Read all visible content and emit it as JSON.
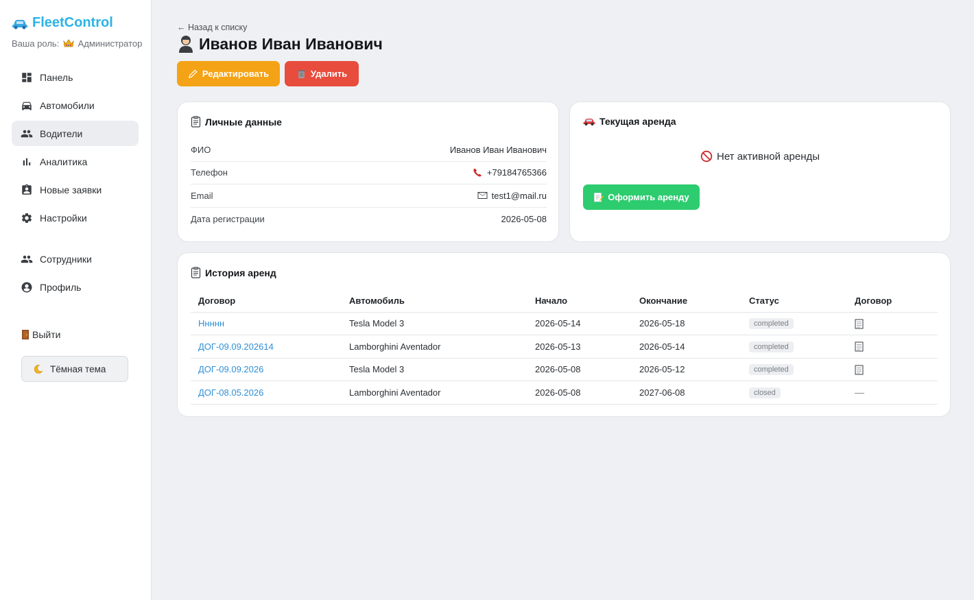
{
  "sidebar": {
    "brand": "FleetControl",
    "role_prefix": "Ваша роль:",
    "role": "Администратор",
    "nav": [
      {
        "label": "Панель",
        "icon": "dashboard-icon"
      },
      {
        "label": "Автомобили",
        "icon": "car-icon"
      },
      {
        "label": "Водители",
        "icon": "people-icon",
        "active": true
      },
      {
        "label": "Аналитика",
        "icon": "bar-chart-icon"
      },
      {
        "label": "Новые заявки",
        "icon": "clipboard-person-icon"
      },
      {
        "label": "Настройки",
        "icon": "gear-icon"
      }
    ],
    "nav2": [
      {
        "label": "Сотрудники",
        "icon": "people-icon"
      },
      {
        "label": "Профиль",
        "icon": "account-circle-icon"
      }
    ],
    "logout": "Выйти",
    "theme": "Тёмная тема"
  },
  "header": {
    "back": "← Назад к списку",
    "title": "Иванов Иван Иванович",
    "edit": "Редактировать",
    "delete": "Удалить"
  },
  "personal": {
    "title": "Личные данные",
    "rows": [
      {
        "label": "ФИО",
        "value": "Иванов Иван Иванович"
      },
      {
        "label": "Телефон",
        "value": "+79184765366"
      },
      {
        "label": "Email",
        "value": "test1@mail.ru"
      },
      {
        "label": "Дата регистрации",
        "value": "2026-05-08"
      }
    ]
  },
  "rent": {
    "title": "Текущая аренда",
    "empty": "Нет активной аренды",
    "button": "Оформить аренду"
  },
  "history": {
    "title": "История аренд",
    "columns": [
      "Договор",
      "Автомобиль",
      "Начало",
      "Окончание",
      "Статус",
      "Договор"
    ],
    "rows": [
      {
        "contract": "Ннннн",
        "car": "Tesla Model 3",
        "start": "2026-05-14",
        "end": "2026-05-18",
        "status": "completed"
      },
      {
        "contract": "ДОГ-09.09.202614",
        "car": "Lamborghini Aventador",
        "start": "2026-05-13",
        "end": "2026-05-14",
        "status": "completed"
      },
      {
        "contract": "ДОГ-09.09.2026",
        "car": "Tesla Model 3",
        "start": "2026-05-08",
        "end": "2026-05-12",
        "status": "completed"
      },
      {
        "contract": "ДОГ-08.05.2026",
        "car": "Lamborghini Aventador",
        "start": "2026-05-08",
        "end": "2027-06-08",
        "status": "closed"
      }
    ]
  },
  "colors": {
    "brand": "#2bb3e6",
    "edit": "#f5a316",
    "delete": "#e84c3d",
    "rent": "#2ccc6f",
    "link": "#2e8fd6"
  }
}
